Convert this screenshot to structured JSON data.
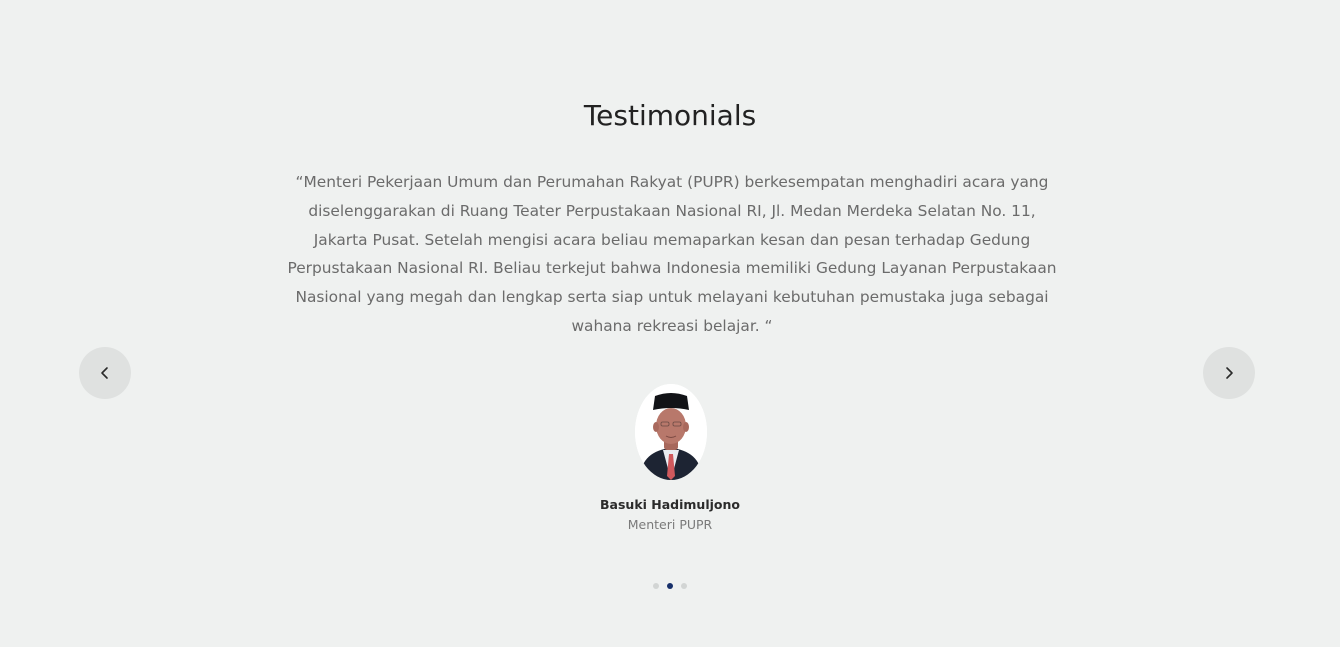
{
  "section": {
    "title": "Testimonials"
  },
  "testimonial": {
    "quote": "“Menteri Pekerjaan Umum dan Perumahan Rakyat (PUPR) berkesempatan menghadiri acara yang diselenggarakan di Ruang Teater Perpustakaan Nasional RI, Jl. Medan Merdeka Selatan No. 11, Jakarta Pusat. Setelah mengisi acara beliau memaparkan kesan dan pesan terhadap Gedung Perpustakaan Nasional RI. Beliau terkejut bahwa Indonesia memiliki Gedung Layanan Perpustakaan Nasional yang megah dan lengkap serta siap untuk melayani kebutuhan pemustaka juga sebagai wahana rekreasi belajar. “",
    "name": "Basuki Hadimuljono",
    "role": "Menteri PUPR"
  },
  "carousel": {
    "prev_icon": "chevron-left-icon",
    "next_icon": "chevron-right-icon",
    "slide_count": 3,
    "active_index": 1,
    "dot_color": "#d2d5d4",
    "active_dot_color": "#17306a"
  },
  "colors": {
    "background": "#eff1f0",
    "nav_button": "#dfe1e0",
    "title": "#222222",
    "quote_text": "#6b6b6b"
  }
}
